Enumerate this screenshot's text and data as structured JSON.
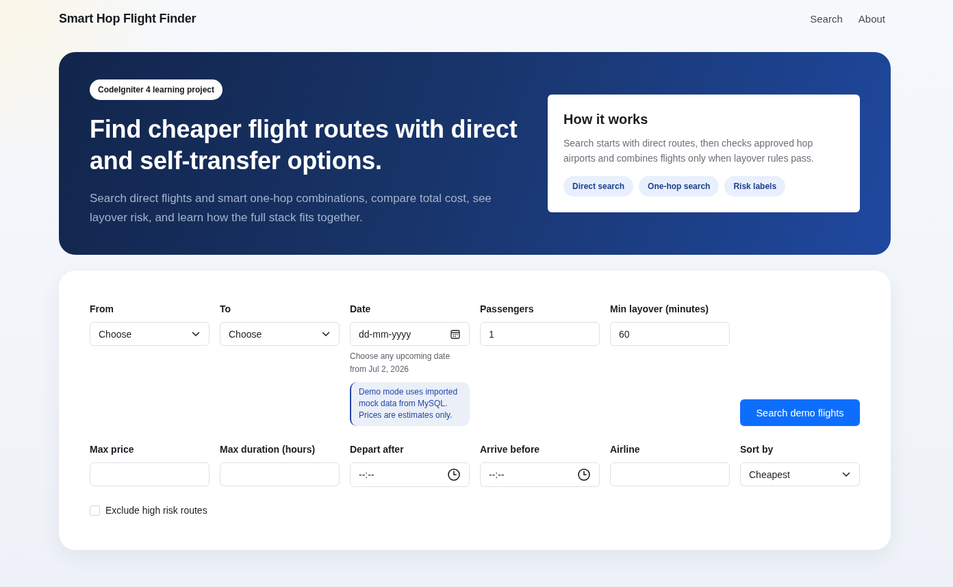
{
  "header": {
    "title": "Smart Hop Flight Finder",
    "nav": [
      "Search",
      "About"
    ]
  },
  "hero": {
    "badge": "CodeIgniter 4 learning project",
    "heading": "Find cheaper flight routes with direct and self-transfer options.",
    "subtitle": "Search direct flights and smart one-hop combinations, compare total cost, see layover risk, and learn how the full stack fits together.",
    "info_card": {
      "title": "How it works",
      "text": "Search starts with direct routes, then checks approved hop airports and combines flights only when layover rules pass.",
      "chips": [
        "Direct search",
        "One-hop search",
        "Risk labels"
      ]
    }
  },
  "search_form": {
    "fields": [
      {
        "kind": "select",
        "label": "From",
        "value": "Choose"
      },
      {
        "kind": "select",
        "label": "To",
        "value": "Choose"
      },
      {
        "kind": "date",
        "label": "Date",
        "placeholder": "dd-mm-yyyy",
        "hint": "Choose any upcoming date from Jul 2, 2026",
        "notice": "Demo mode uses imported mock data from MySQL. Prices are estimates only."
      },
      {
        "kind": "number",
        "label": "Passengers",
        "value": "1"
      },
      {
        "kind": "number",
        "label": "Min layover (minutes)",
        "value": "60"
      },
      {
        "kind": "button",
        "label": "Search demo flights"
      },
      {
        "kind": "number",
        "label": "Max price"
      },
      {
        "kind": "number",
        "label": "Max duration (hours)"
      },
      {
        "kind": "time",
        "label": "Depart after",
        "placeholder": "--:--"
      },
      {
        "kind": "time",
        "label": "Arrive before",
        "placeholder": "--:--"
      },
      {
        "kind": "text",
        "label": "Airline"
      },
      {
        "kind": "select",
        "label": "Sort by",
        "value": "Cheapest"
      }
    ],
    "checkbox": {
      "label": "Exclude high risk routes",
      "checked": false
    }
  }
}
